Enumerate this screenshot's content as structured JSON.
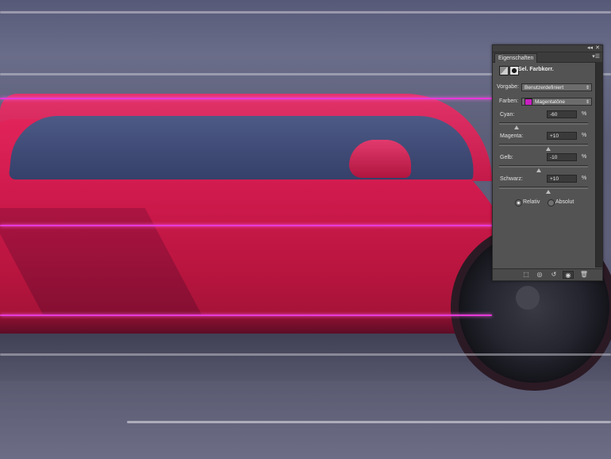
{
  "panel": {
    "tab_label": "Eigenschaften",
    "collapse_icon": "double-chevron-icon",
    "close_icon": "close-icon",
    "menu_icon": "panel-menu-icon",
    "adjustment_title": "Sel. Farbkorr.",
    "preset": {
      "label": "Vorgabe:",
      "value": "Benutzerdefiniert"
    },
    "colors": {
      "label": "Farben:",
      "value": "Magentatöne",
      "swatch": "#c81fc1"
    },
    "sliders": [
      {
        "label": "Cyan:",
        "value": "-60",
        "unit": "%",
        "level": 0.2
      },
      {
        "label": "Magenta:",
        "value": "+10",
        "unit": "%",
        "level": 0.55
      },
      {
        "label": "Gelb:",
        "value": "-10",
        "unit": "%",
        "level": 0.45
      },
      {
        "label": "Schwarz:",
        "value": "+10",
        "unit": "%",
        "level": 0.55
      }
    ],
    "method": {
      "relative_label": "Relativ",
      "absolute_label": "Absolut",
      "selected": "Relativ"
    },
    "footer_icons": [
      "clip-to-layer-icon",
      "view-previous-state-icon",
      "reset-icon",
      "visibility-eye-icon",
      "trash-icon"
    ]
  },
  "colors": {
    "panel_bg": "#535353",
    "accent_magenta": "#c81fc1",
    "car_red": "#d01c4f"
  }
}
